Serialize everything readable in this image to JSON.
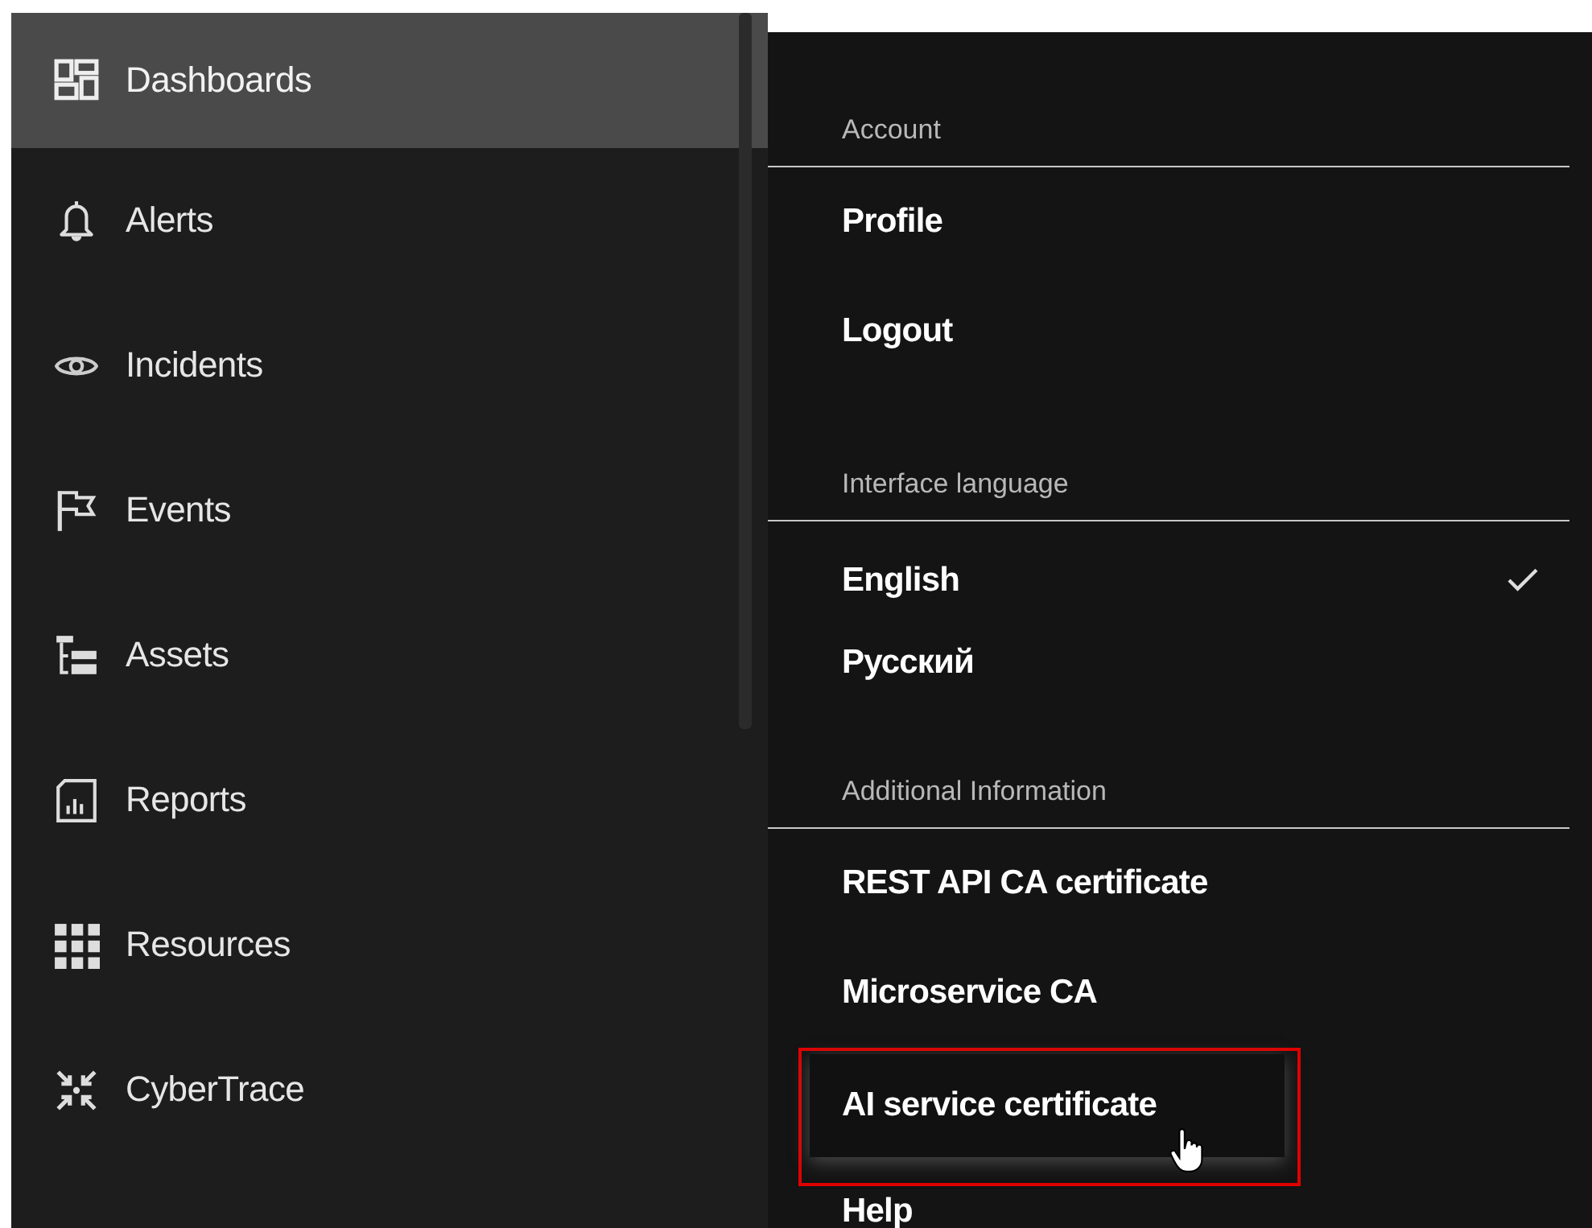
{
  "sidebar": {
    "items": [
      {
        "label": "Dashboards",
        "selected": true
      },
      {
        "label": "Alerts",
        "selected": false
      },
      {
        "label": "Incidents",
        "selected": false
      },
      {
        "label": "Events",
        "selected": false
      },
      {
        "label": "Assets",
        "selected": false
      },
      {
        "label": "Reports",
        "selected": false
      },
      {
        "label": "Resources",
        "selected": false
      },
      {
        "label": "CyberTrace",
        "selected": false
      }
    ]
  },
  "menu": {
    "sections": [
      {
        "title": "Account",
        "items": [
          {
            "label": "Profile",
            "kind": "link"
          },
          {
            "label": "Logout",
            "kind": "link"
          }
        ]
      },
      {
        "title": "Interface language",
        "items": [
          {
            "label": "English",
            "kind": "option",
            "selected": true
          },
          {
            "label": "Русский",
            "kind": "option",
            "selected": false
          }
        ]
      },
      {
        "title": "Additional Information",
        "items": [
          {
            "label": "REST API CA certificate",
            "kind": "link"
          },
          {
            "label": "Microservice CA",
            "kind": "link"
          },
          {
            "label": "AI service certificate",
            "kind": "link",
            "highlighted": true
          },
          {
            "label": "Help",
            "kind": "link"
          }
        ]
      }
    ]
  }
}
